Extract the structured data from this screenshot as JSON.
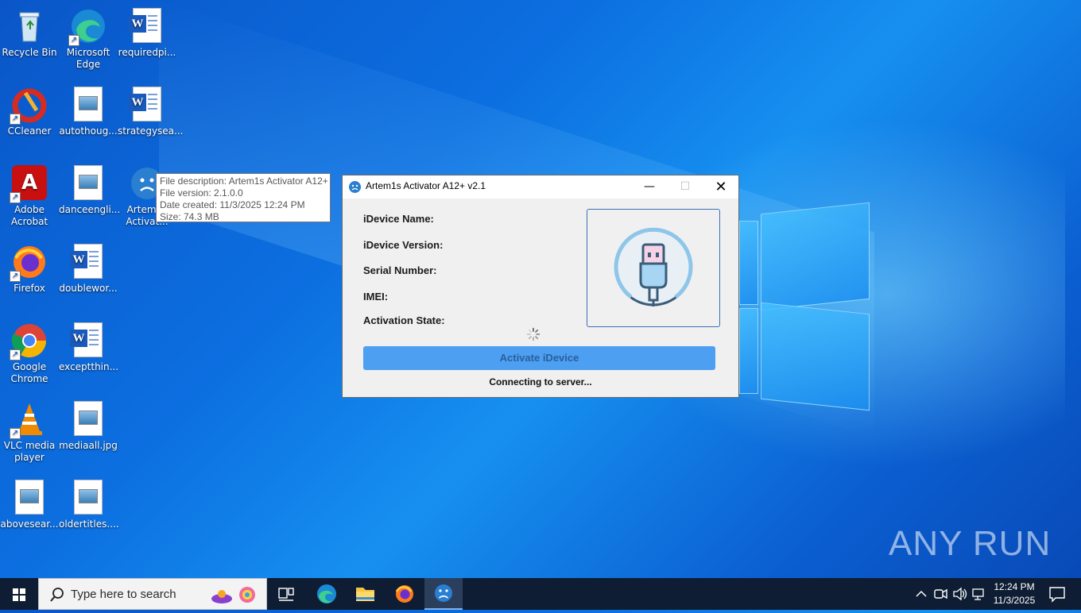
{
  "desktop": {
    "icons": [
      {
        "label": "Recycle Bin"
      },
      {
        "label": "Microsoft Edge"
      },
      {
        "label": "requiredpi..."
      },
      {
        "label": "CCleaner"
      },
      {
        "label": "autothoug..."
      },
      {
        "label": "strategysea..."
      },
      {
        "label": "Adobe Acrobat"
      },
      {
        "label": "danceengli..."
      },
      {
        "label": "Artem1s Activat..."
      },
      {
        "label": "Firefox"
      },
      {
        "label": "doublewor..."
      },
      {
        "label": "Google Chrome"
      },
      {
        "label": "exceptthin..."
      },
      {
        "label": "VLC media player"
      },
      {
        "label": "mediaall.jpg"
      },
      {
        "label": "abovesear..."
      },
      {
        "label": "oldertitles...."
      }
    ]
  },
  "tooltip": {
    "line1": "File description: Artem1s Activator A12+",
    "line2": "File version: 2.1.0.0",
    "line3": "Date created: 11/3/2025 12:24 PM",
    "line4": "Size: 74.3 MB"
  },
  "dialog": {
    "title": "Artem1s Activator A12+ v2.1",
    "fields": {
      "device_name": "iDevice Name:",
      "device_version": "iDevice Version:",
      "serial": "Serial Number:",
      "imei": "IMEI:",
      "activation_state": "Activation State:"
    },
    "activate_label": "Activate iDevice",
    "status": "Connecting to server...",
    "icon": "usb-cable-icon"
  },
  "watermark": "ANY RUN",
  "taskbar": {
    "search_placeholder": "Type here to search",
    "time": "12:24 PM",
    "date": "11/3/2025"
  },
  "colors": {
    "accent": "#4d9ff2",
    "taskbar": "#0e1d34",
    "desktop": "#0c6fe0"
  }
}
